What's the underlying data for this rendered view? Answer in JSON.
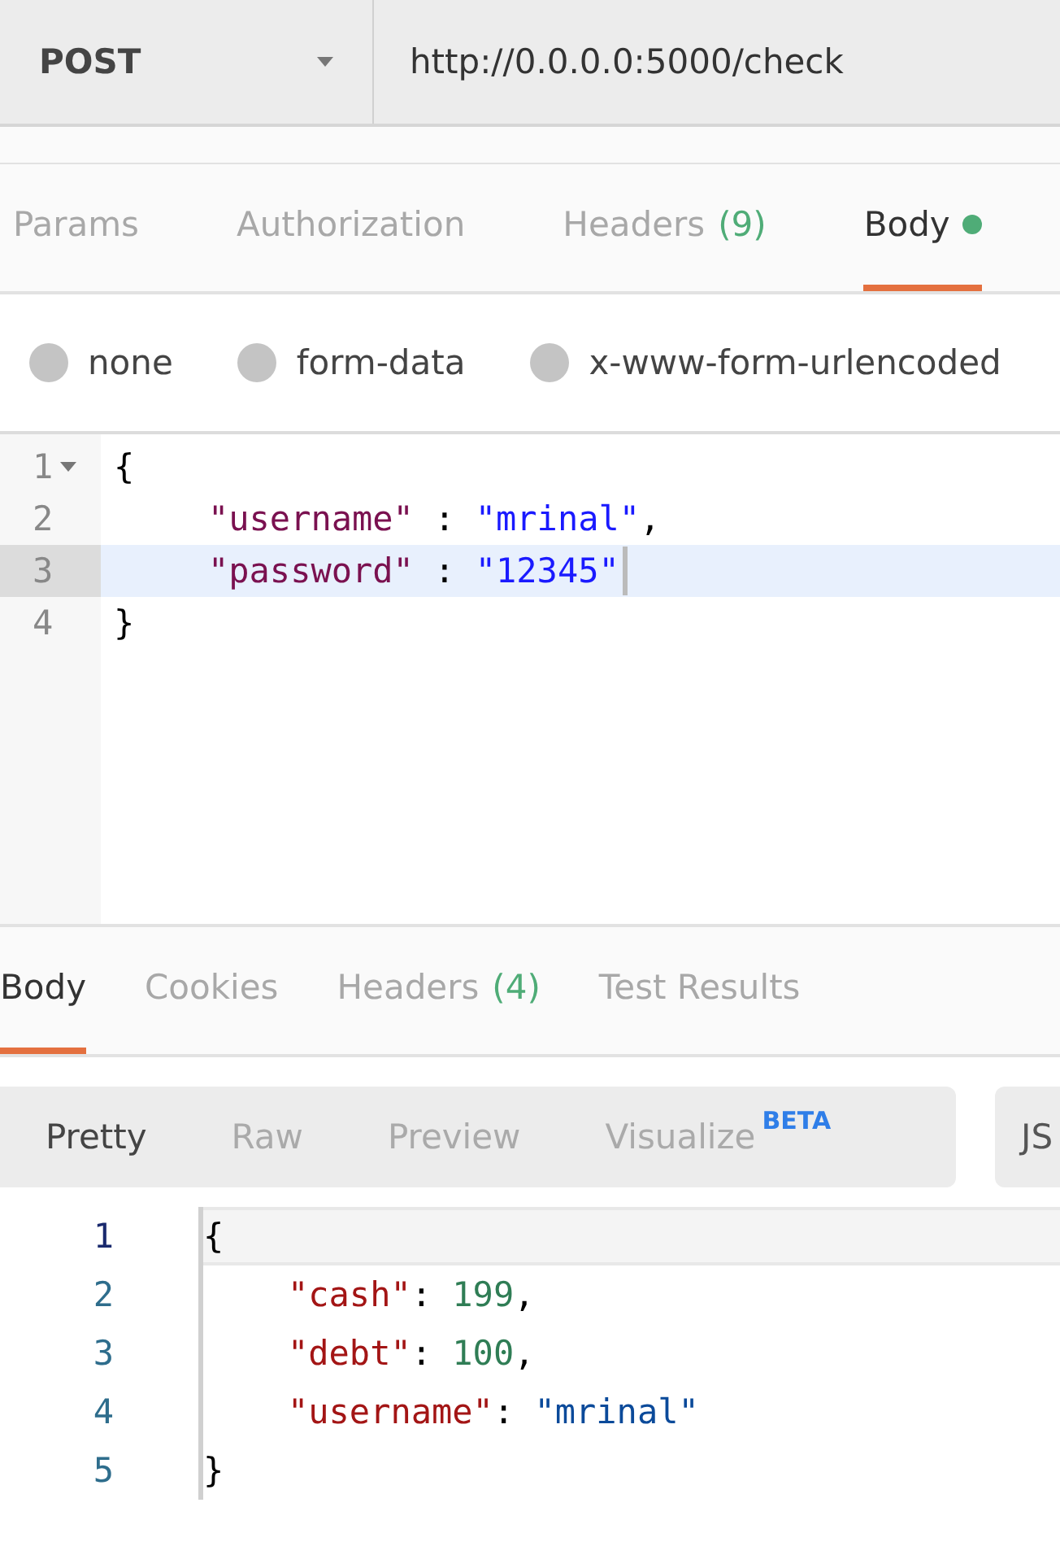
{
  "request": {
    "method": "POST",
    "url": "http://0.0.0.0:5000/check"
  },
  "request_tabs": [
    {
      "label": "Params",
      "selected": false
    },
    {
      "label": "Authorization",
      "selected": false
    },
    {
      "label": "Headers",
      "count": "(9)",
      "selected": false
    },
    {
      "label": "Body",
      "selected": true,
      "has_content": true
    }
  ],
  "body_types": [
    {
      "label": "none",
      "selected": false
    },
    {
      "label": "form-data",
      "selected": false
    },
    {
      "label": "x-www-form-urlencoded",
      "selected": false
    }
  ],
  "request_body": [
    {
      "number": "1",
      "active": false,
      "foldable": true,
      "indent": false,
      "tokens": [
        {
          "text": "{",
          "kind": "punct"
        }
      ]
    },
    {
      "number": "2",
      "active": false,
      "foldable": false,
      "indent": true,
      "tokens": [
        {
          "text": "\"username\"",
          "kind": "key"
        },
        {
          "text": " : ",
          "kind": "punct"
        },
        {
          "text": "\"mrinal\"",
          "kind": "string"
        },
        {
          "text": ",",
          "kind": "punct"
        }
      ]
    },
    {
      "number": "3",
      "active": true,
      "foldable": false,
      "indent": true,
      "tokens": [
        {
          "text": "\"password\"",
          "kind": "key"
        },
        {
          "text": " : ",
          "kind": "punct"
        },
        {
          "text": "\"12345\"",
          "kind": "string"
        }
      ]
    },
    {
      "number": "4",
      "active": false,
      "foldable": false,
      "indent": false,
      "tokens": [
        {
          "text": "}",
          "kind": "punct"
        }
      ]
    }
  ],
  "response_tabs": [
    {
      "label": "Body",
      "selected": true
    },
    {
      "label": "Cookies",
      "selected": false
    },
    {
      "label": "Headers",
      "count": "(4)",
      "selected": false
    },
    {
      "label": "Test Results",
      "selected": false
    }
  ],
  "view_modes": [
    {
      "label": "Pretty",
      "selected": true
    },
    {
      "label": "Raw",
      "selected": false
    },
    {
      "label": "Preview",
      "selected": false
    },
    {
      "label": "Visualize",
      "badge": "BETA",
      "selected": false
    }
  ],
  "format": {
    "label": "JS"
  },
  "response_body": [
    {
      "number": "1",
      "active": true,
      "indent": false,
      "tokens": [
        {
          "text": "{",
          "kind": "punct"
        }
      ]
    },
    {
      "number": "2",
      "active": false,
      "indent": true,
      "tokens": [
        {
          "text": "\"cash\"",
          "kind": "key"
        },
        {
          "text": ": ",
          "kind": "punct"
        },
        {
          "text": "199",
          "kind": "number"
        },
        {
          "text": ",",
          "kind": "punct"
        }
      ]
    },
    {
      "number": "3",
      "active": false,
      "indent": true,
      "tokens": [
        {
          "text": "\"debt\"",
          "kind": "key"
        },
        {
          "text": ": ",
          "kind": "punct"
        },
        {
          "text": "100",
          "kind": "number"
        },
        {
          "text": ",",
          "kind": "punct"
        }
      ]
    },
    {
      "number": "4",
      "active": false,
      "indent": true,
      "tokens": [
        {
          "text": "\"username\"",
          "kind": "key"
        },
        {
          "text": ": ",
          "kind": "punct"
        },
        {
          "text": "\"mrinal\"",
          "kind": "string"
        }
      ]
    },
    {
      "number": "5",
      "active": false,
      "indent": false,
      "tokens": [
        {
          "text": "}",
          "kind": "punct"
        }
      ]
    }
  ]
}
